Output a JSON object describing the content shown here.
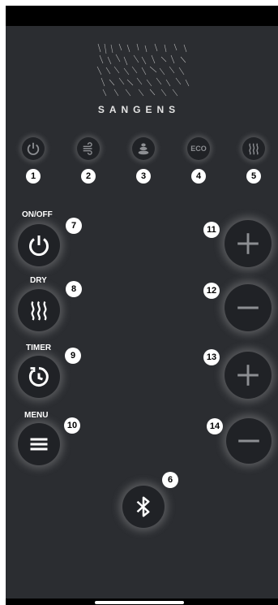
{
  "brand": {
    "name": "SANGENS"
  },
  "small_buttons": [
    {
      "badge": "1",
      "icon": "power-icon"
    },
    {
      "badge": "2",
      "icon": "wind-icon"
    },
    {
      "badge": "3",
      "icon": "stones-icon"
    },
    {
      "badge": "4",
      "icon": "eco-icon",
      "text": "ECO"
    },
    {
      "badge": "5",
      "icon": "steam-waves-icon"
    }
  ],
  "left_buttons": [
    {
      "label": "ON/OFF",
      "badge": "7",
      "icon": "power-icon"
    },
    {
      "label": "DRY",
      "badge": "8",
      "icon": "steam-waves-icon"
    },
    {
      "label": "TIMER",
      "badge": "9",
      "icon": "timer-icon"
    },
    {
      "label": "MENU",
      "badge": "10",
      "icon": "menu-icon"
    }
  ],
  "right_buttons": [
    {
      "badge": "11",
      "icon": "plus-icon"
    },
    {
      "badge": "12",
      "icon": "minus-icon"
    },
    {
      "badge": "13",
      "icon": "plus-icon"
    },
    {
      "badge": "14",
      "icon": "minus-icon"
    }
  ],
  "bluetooth": {
    "badge": "6",
    "icon": "bluetooth-icon"
  },
  "colors": {
    "panel": "#2b2d31",
    "button": "#202226",
    "icon_dim": "#8d8f93",
    "icon_bright": "#ffffff"
  }
}
